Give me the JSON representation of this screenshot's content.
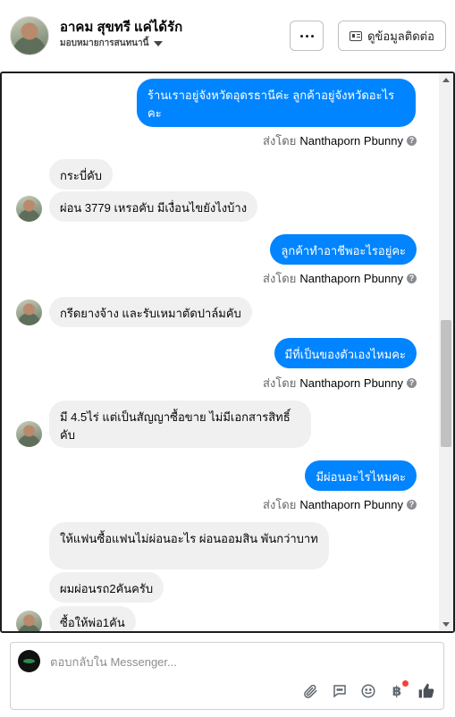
{
  "header": {
    "contact_name": "อาคม สุขทรี แค่ได้รัก",
    "assign_label": "มอบหมายการสนทนานี้",
    "profile_button_label": "ดูข้อมูลติดต่อ"
  },
  "messages": [
    {
      "kind": "out",
      "text": "ร้านเราอยู่จังหวัดอุดรธานีค่ะ ลูกค้าอยู่จังหวัดอะไรคะ"
    },
    {
      "kind": "sent_by",
      "prefix": "ส่งโดย",
      "name": "Nanthaporn Pbunny"
    },
    {
      "kind": "in",
      "text": "กระบี่คับ"
    },
    {
      "kind": "in",
      "text": "ผ่อน 3779 เหรอคับ มีเงื่อนไขยังไงบ้าง"
    },
    {
      "kind": "out",
      "text": "ลูกค้าทำอาชีพอะไรอยู่คะ"
    },
    {
      "kind": "sent_by",
      "prefix": "ส่งโดย",
      "name": "Nanthaporn Pbunny"
    },
    {
      "kind": "in",
      "text": "กรีดยางจ้าง และรับเหมาตัดปาล์มคับ"
    },
    {
      "kind": "out",
      "text": "มีที่เป็นของตัวเองไหมคะ"
    },
    {
      "kind": "sent_by",
      "prefix": "ส่งโดย",
      "name": "Nanthaporn Pbunny"
    },
    {
      "kind": "in",
      "text": "มี 4.5ไร่ แต่เป็นสัญญาซื้อขาย ไม่มีเอกสารสิทธิ์คับ"
    },
    {
      "kind": "out",
      "text": "มีผ่อนอะไรไหมคะ"
    },
    {
      "kind": "sent_by",
      "prefix": "ส่งโดย",
      "name": "Nanthaporn Pbunny"
    },
    {
      "kind": "in",
      "text": "ให้แฟนซื้อแฟนไม่ผ่อนอะไร ผ่อนออมสิน พันกว่าบาท"
    },
    {
      "kind": "in",
      "text": "ผมผ่อนรถ2คันครับ"
    },
    {
      "kind": "in",
      "text": "ซื้อให้พ่อ1คัน"
    }
  ],
  "composer": {
    "placeholder": "ตอบกลับใน Messenger...",
    "icons": [
      "paperclip-icon",
      "quick-reply-icon",
      "emoji-icon",
      "baht-payment-icon",
      "thumbs-up-icon"
    ],
    "accent_color": "#0084ff"
  }
}
